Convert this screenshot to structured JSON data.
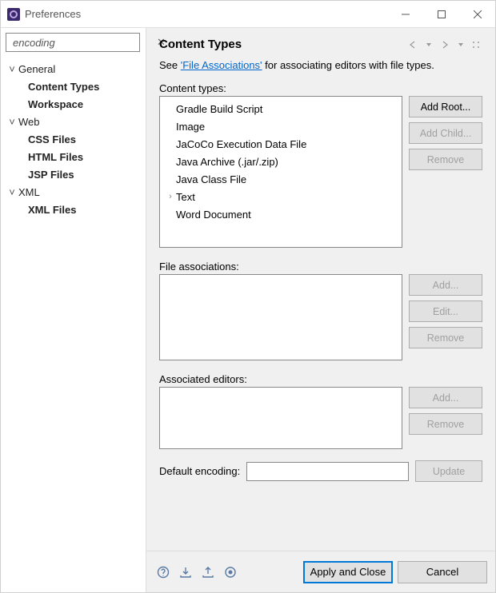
{
  "window": {
    "title": "Preferences"
  },
  "search": {
    "value": "encoding",
    "clear_glyph": "✕"
  },
  "tree": {
    "nodes": [
      {
        "label": "General",
        "children": [
          "Content Types",
          "Workspace"
        ]
      },
      {
        "label": "Web",
        "children": [
          "CSS Files",
          "HTML Files",
          "JSP Files"
        ]
      },
      {
        "label": "XML",
        "children": [
          "XML Files"
        ]
      }
    ]
  },
  "page": {
    "title": "Content Types",
    "intro_prefix": "See ",
    "intro_link": "'File Associations'",
    "intro_suffix": " for associating editors with file types.",
    "content_types_label": "Content types:",
    "content_types": [
      "Gradle Build Script",
      "Image",
      "JaCoCo Execution Data File",
      "Java Archive (.jar/.zip)",
      "Java Class File",
      "Text",
      "Word Document"
    ],
    "buttons_types": {
      "add_root": "Add Root...",
      "add_child": "Add Child...",
      "remove": "Remove"
    },
    "file_assoc_label": "File associations:",
    "buttons_assoc": {
      "add": "Add...",
      "edit": "Edit...",
      "remove": "Remove"
    },
    "assoc_editors_label": "Associated editors:",
    "buttons_editors": {
      "add": "Add...",
      "remove": "Remove"
    },
    "default_encoding_label": "Default encoding:",
    "default_encoding_value": "",
    "update_btn": "Update"
  },
  "footer": {
    "apply_close": "Apply and Close",
    "cancel": "Cancel"
  }
}
